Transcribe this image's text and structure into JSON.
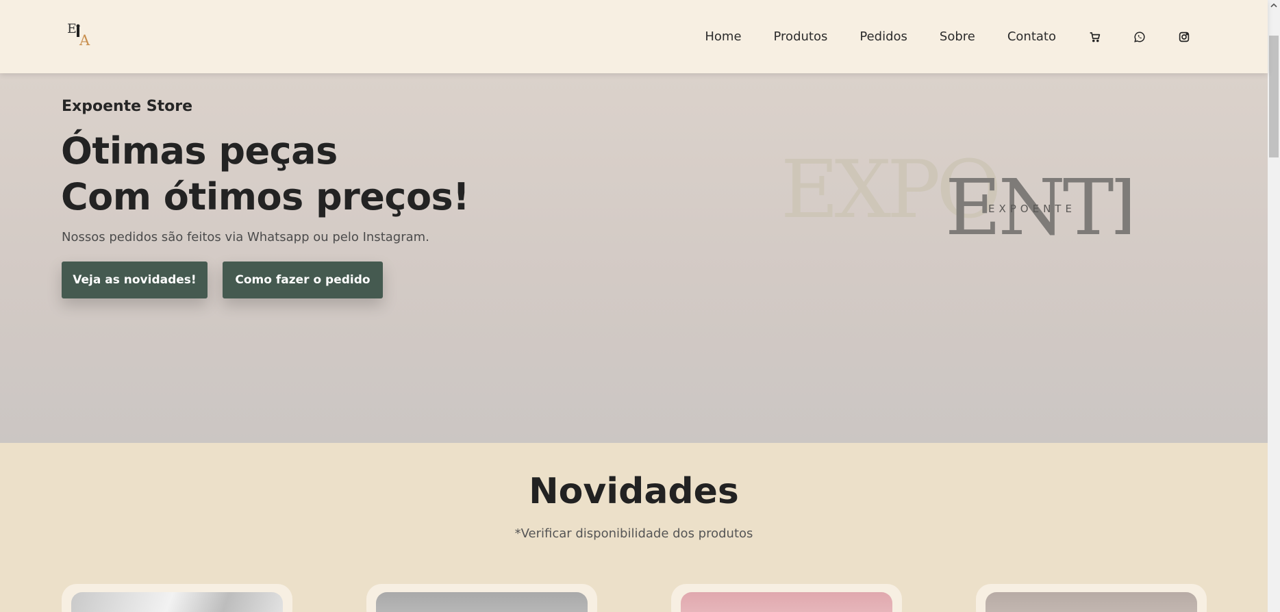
{
  "nav": {
    "links": [
      "Home",
      "Produtos",
      "Pedidos",
      "Sobre",
      "Contato"
    ],
    "icons": [
      "cart-icon",
      "whatsapp-icon",
      "instagram-icon"
    ]
  },
  "hero": {
    "kicker": "Expoente Store",
    "title_line1": "Ótimas peças",
    "title_line2": "Com ótimos preços!",
    "subtitle": "Nossos pedidos são feitos via Whatsapp ou pelo Instagram.",
    "btn_primary": "Veja as novidades!",
    "btn_secondary": "Como fazer o pedido",
    "brand_logo_text": "EXPOENTE"
  },
  "novidades": {
    "title": "Novidades",
    "subtitle": "*Verificar disponibilidade dos produtos"
  },
  "colors": {
    "nav_bg": "#f7efe2",
    "hero_bg": "#d8cfc9",
    "section_bg": "#ece0c9",
    "button": "#455a50"
  }
}
